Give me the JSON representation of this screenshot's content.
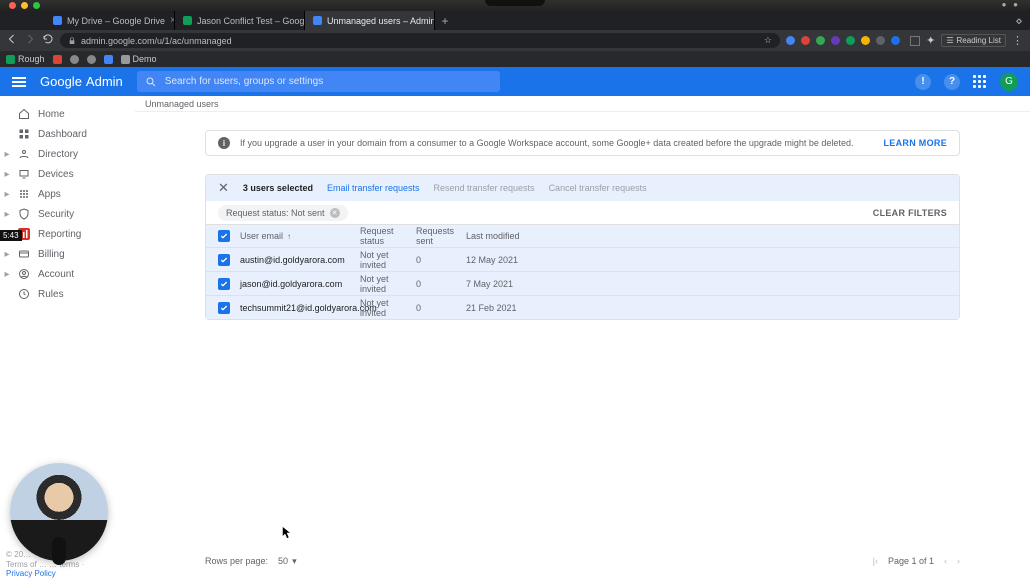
{
  "os": {
    "menuRightHint": "●  ●"
  },
  "browser": {
    "tabs": [
      {
        "title": "My Drive – Google Drive",
        "favClass": ""
      },
      {
        "title": "Jason Conflict Test – Google S",
        "favClass": "sheets"
      },
      {
        "title": "Unmanaged users – Admin Co",
        "favClass": ""
      }
    ],
    "url": "admin.google.com/u/1/ac/unmanaged",
    "reading_list": "Reading List"
  },
  "bookmarks": {
    "items": [
      "Rough",
      "",
      "",
      "",
      "",
      "Demo"
    ]
  },
  "header": {
    "brand1": "Google",
    "brand2": "Admin",
    "search_placeholder": "Search for users, groups or settings",
    "avatar_letter": "G"
  },
  "sidebar": {
    "items": [
      {
        "label": "Home",
        "icon": "home"
      },
      {
        "label": "Dashboard",
        "icon": "dash"
      },
      {
        "label": "Directory",
        "icon": "dir",
        "expandable": true
      },
      {
        "label": "Devices",
        "icon": "dev",
        "expandable": true
      },
      {
        "label": "Apps",
        "icon": "apps",
        "expandable": true
      },
      {
        "label": "Security",
        "icon": "sec",
        "expandable": true
      },
      {
        "label": "Reporting",
        "icon": "rep",
        "expandable": true,
        "accent": true
      },
      {
        "label": "Billing",
        "icon": "bill",
        "expandable": true
      },
      {
        "label": "Account",
        "icon": "acc",
        "expandable": true
      },
      {
        "label": "Rules",
        "icon": "rules"
      }
    ],
    "time_badge": "5:43"
  },
  "breadcrumb": "Unmanaged users",
  "banner": {
    "text": "If you upgrade a user in your domain from a consumer to a Google Workspace account, some Google+ data created before the upgrade might be deleted.",
    "learn": "LEARN MORE"
  },
  "actionbar": {
    "selected": "3 users selected",
    "actions": {
      "email": "Email transfer requests",
      "resend": "Resend transfer requests",
      "cancel": "Cancel transfer requests"
    }
  },
  "filter": {
    "chip": "Request status: Not sent",
    "clear": "CLEAR FILTERS"
  },
  "table": {
    "headers": {
      "email": "User email",
      "status": "Request status",
      "sent": "Requests sent",
      "modified": "Last modified"
    },
    "rows": [
      {
        "email": "austin@id.goldyarora.com",
        "status": "Not yet invited",
        "sent": "0",
        "modified": "12 May 2021"
      },
      {
        "email": "jason@id.goldyarora.com",
        "status": "Not yet invited",
        "sent": "0",
        "modified": "7 May 2021"
      },
      {
        "email": "techsummit21@id.goldyarora.com",
        "status": "Not yet invited",
        "sent": "0",
        "modified": "21 Feb 2021"
      }
    ]
  },
  "footer": {
    "rpp_label": "Rows per page:",
    "rpp_value": "50",
    "page": "Page 1 of 1"
  },
  "legal": {
    "privacy": "Privacy Policy"
  }
}
